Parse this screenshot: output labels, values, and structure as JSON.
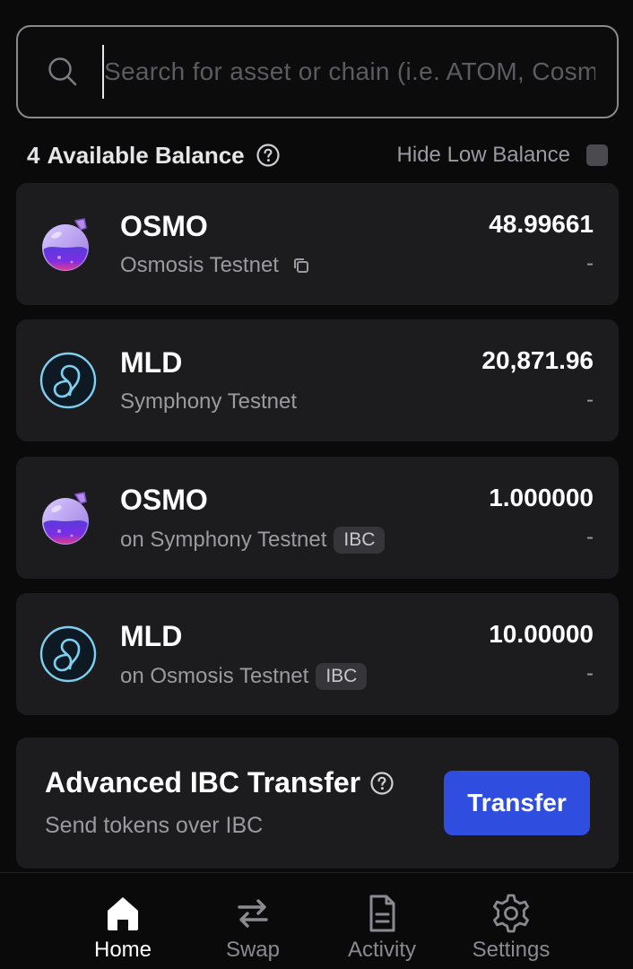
{
  "search": {
    "placeholder": "Search for asset or chain (i.e. ATOM, Cosmos)",
    "value": ""
  },
  "balance_header": {
    "count": "4",
    "label": "Available Balance",
    "hide_low_label": "Hide Low Balance",
    "hide_low_checked": false
  },
  "assets": [
    {
      "symbol": "OSMO",
      "chain": "Osmosis Testnet",
      "ibc": "",
      "amount": "48.99661",
      "usd": "-",
      "icon": "osmosis-flask-icon"
    },
    {
      "symbol": "MLD",
      "chain": "Symphony Testnet",
      "ibc": "",
      "amount": "20,871.96",
      "usd": "-",
      "icon": "symphony-logo-icon"
    },
    {
      "symbol": "OSMO",
      "chain": "on Symphony Testnet",
      "ibc": "IBC",
      "amount": "1.000000",
      "usd": "-",
      "icon": "osmosis-flask-icon"
    },
    {
      "symbol": "MLD",
      "chain": "on Osmosis Testnet",
      "ibc": "IBC",
      "amount": "10.00000",
      "usd": "-",
      "icon": "symphony-logo-icon"
    }
  ],
  "advanced_ibc": {
    "title": "Advanced IBC Transfer",
    "subtitle": "Send tokens over IBC",
    "button_label": "Transfer"
  },
  "nav": {
    "items": [
      {
        "label": "Home",
        "icon": "home-icon",
        "active": true
      },
      {
        "label": "Swap",
        "icon": "swap-icon",
        "active": false
      },
      {
        "label": "Activity",
        "icon": "activity-icon",
        "active": false
      },
      {
        "label": "Settings",
        "icon": "settings-icon",
        "active": false
      }
    ]
  },
  "colors": {
    "background": "#0a0a0b",
    "card": "#1c1c1f",
    "accent": "#2f4ee0",
    "muted_text": "#9a9aa0"
  }
}
